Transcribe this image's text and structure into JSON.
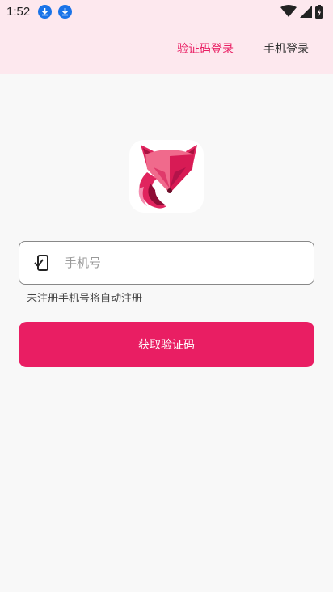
{
  "status_bar": {
    "time": "1:52",
    "icons": [
      "download-icon",
      "download-icon",
      "wifi-icon",
      "signal-icon",
      "battery-icon"
    ]
  },
  "tabs": {
    "code_login": "验证码登录",
    "phone_login": "手机登录",
    "active": "code_login"
  },
  "logo": {
    "icon": "fox-logo-icon"
  },
  "phone_field": {
    "placeholder": "手机号",
    "value": "",
    "icon": "phone-check-icon"
  },
  "hint": "未注册手机号将自动注册",
  "get_code_button": "获取验证码",
  "colors": {
    "accent": "#e91e63",
    "header_bg": "#fde8ee",
    "page_bg": "#f8f8f8"
  }
}
